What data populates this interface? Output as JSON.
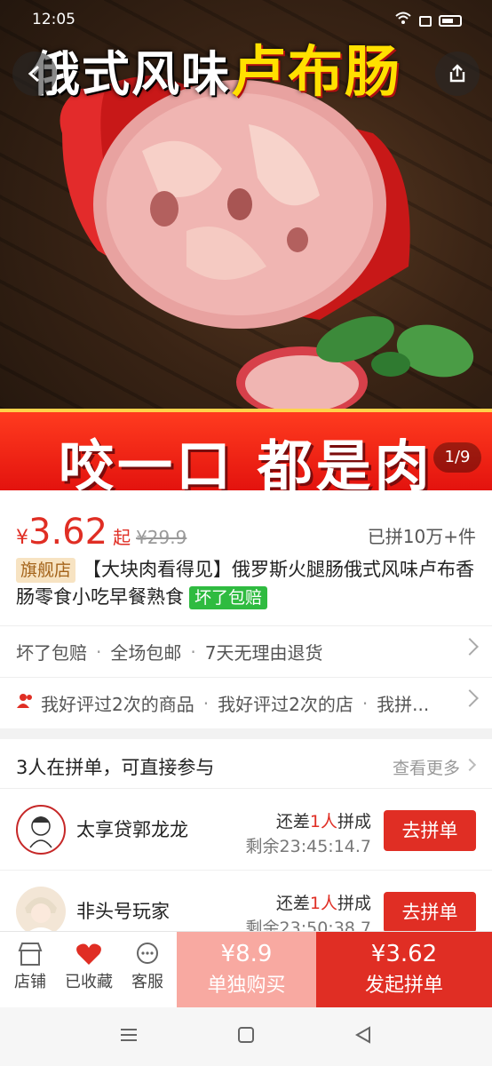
{
  "status_bar": {
    "time": "12:05"
  },
  "hero": {
    "title_white": "俄式风味",
    "title_yellow": "卢布肠",
    "banner": "咬一口 都是肉",
    "pager": "1/9"
  },
  "product": {
    "currency": "¥",
    "price": "3.62",
    "price_suffix": "起",
    "original_price": "¥29.9",
    "sold": "已拼10万+件",
    "flag_tag": "旗舰店",
    "title": "【大块肉看得见】俄罗斯火腿肠俄式风味卢布香肠零食小吃早餐熟食",
    "green_tag": "坏了包赔"
  },
  "services": {
    "row1": [
      "坏了包赔",
      "全场包邮",
      "7天无理由退货"
    ],
    "row2": [
      "我好评过2次的商品",
      "我好评过2次的店",
      "我拼..."
    ]
  },
  "group": {
    "title": "3人在拼单，可直接参与",
    "more": "查看更多",
    "rows": [
      {
        "name": "太享贷郭龙龙",
        "need_prefix": "还差",
        "need_count": "1人",
        "need_suffix": "拼成",
        "time_left": "剩余23:45:14.7",
        "button": "去拼单"
      },
      {
        "name": "非头号玩家",
        "need_prefix": "还差",
        "need_count": "1人",
        "need_suffix": "拼成",
        "time_left": "剩余23:50:38.7",
        "button": "去拼单"
      }
    ]
  },
  "bottom_bar": {
    "store": "店铺",
    "favorited": "已收藏",
    "service": "客服",
    "solo_price": "¥8.9",
    "solo_label": "单独购买",
    "group_price": "¥3.62",
    "group_label": "发起拼单"
  },
  "colors": {
    "accent": "#e02e24",
    "solo": "#f8a9a1",
    "green_tag": "#2fbb40",
    "banner": "#e3130e",
    "title_yellow": "#ffe000"
  },
  "icons": [
    "back-icon",
    "share-icon",
    "chevron-right-icon",
    "people-icon",
    "store-icon",
    "heart-icon",
    "chat-icon",
    "menu-nav-icon",
    "home-nav-icon",
    "back-nav-icon"
  ]
}
